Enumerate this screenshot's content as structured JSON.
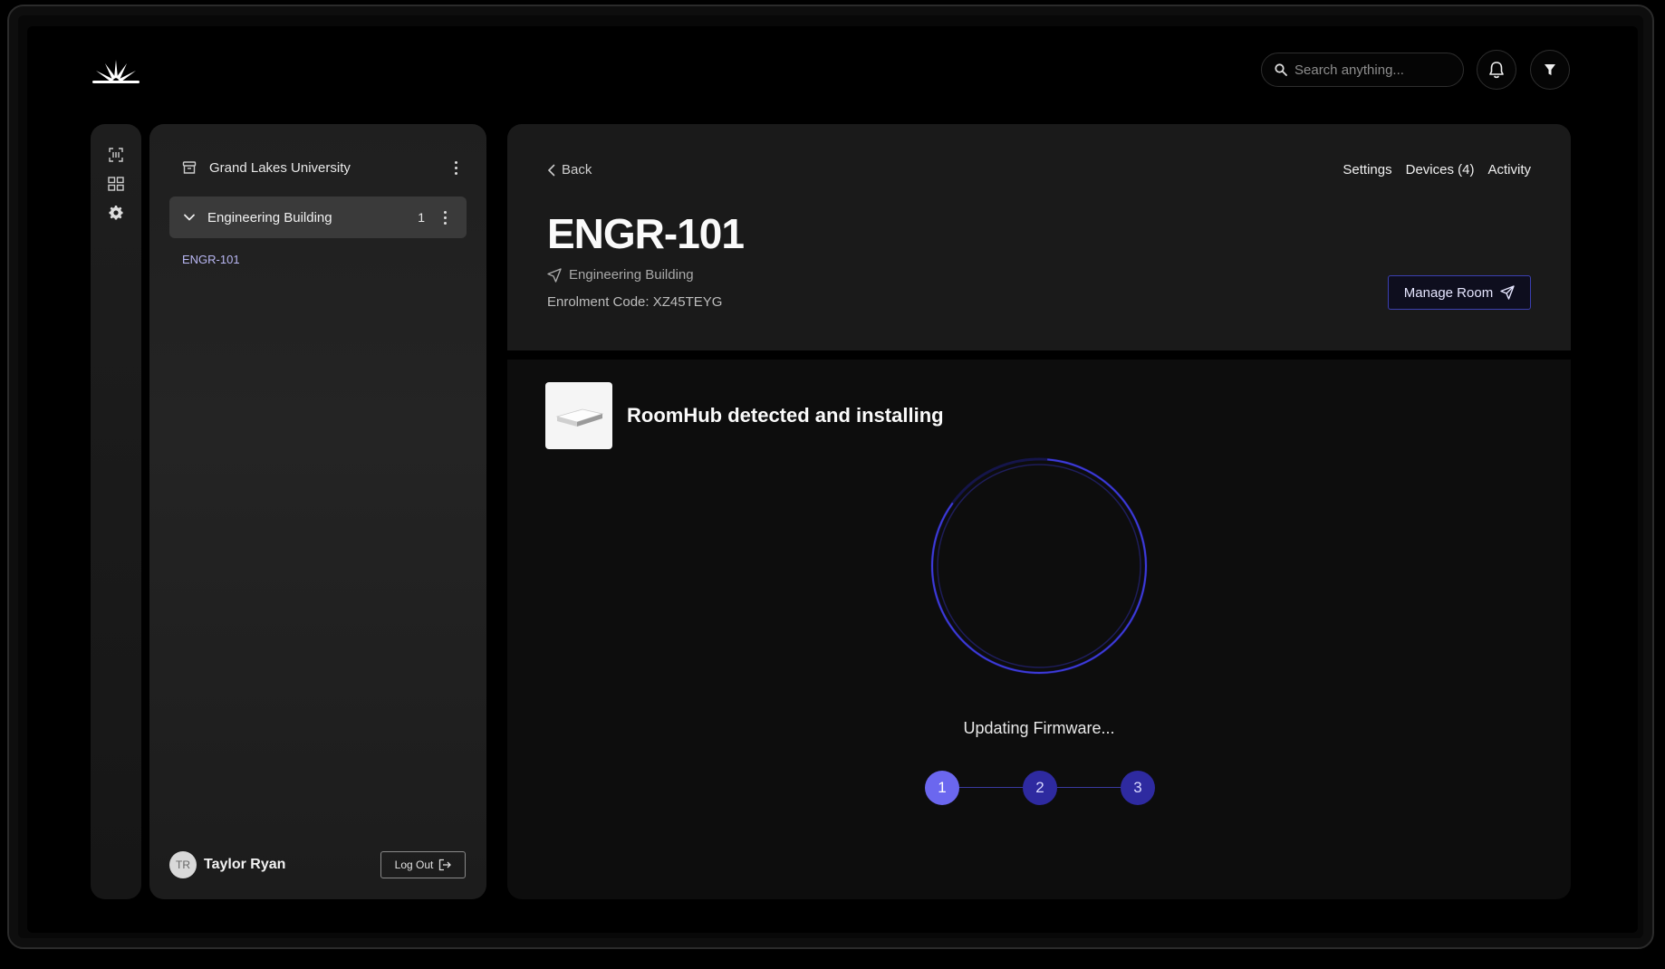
{
  "search": {
    "placeholder": "Search anything..."
  },
  "sidebar": {
    "org_name": "Grand Lakes University",
    "building": {
      "name": "Engineering Building",
      "count": "1"
    },
    "rooms": [
      "ENGR-101"
    ],
    "user": {
      "initials": "TR",
      "name": "Taylor Ryan"
    },
    "logout_label": "Log Out"
  },
  "room": {
    "back_label": "Back",
    "tabs": [
      "Settings",
      "Devices (4)",
      "Activity"
    ],
    "title": "ENGR-101",
    "location": "Engineering Building",
    "enrolment_label": "Enrolment Code:",
    "enrolment_code": "XZ45TEYG",
    "manage_label": "Manage Room"
  },
  "install": {
    "title": "RoomHub detected and installing",
    "status": "Updating Firmware...",
    "steps": [
      "1",
      "2",
      "3"
    ],
    "current_step": 1
  },
  "colors": {
    "accent": "#6b67ef",
    "accent_dark": "#2e2aa0",
    "room_link": "#b9b7f3"
  }
}
